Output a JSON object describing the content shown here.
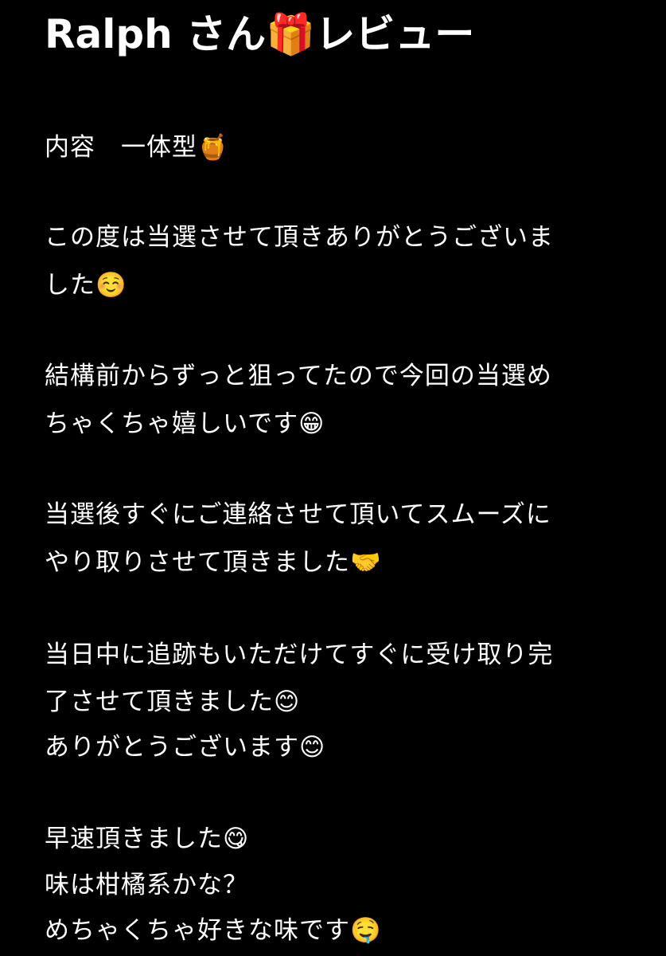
{
  "note": {
    "title": "Ralph さん🎁レビュー",
    "lines": [
      "内容　一体型🍯",
      "この度は当選させて頂きありがとうございま",
      "した☺️",
      "結構前からずっと狙ってたので今回の当選め",
      "ちゃくちゃ嬉しいです😁",
      "当選後すぐにご連絡させて頂いてスムーズに",
      "やり取りさせて頂きました🤝",
      "当日中に追跡もいただけてすぐに受け取り完",
      "了させて頂きました😊",
      "ありがとうございます😊",
      "早速頂きました😋",
      "味は柑橘系かな？",
      "めちゃくちゃ好きな味です🤤"
    ]
  }
}
